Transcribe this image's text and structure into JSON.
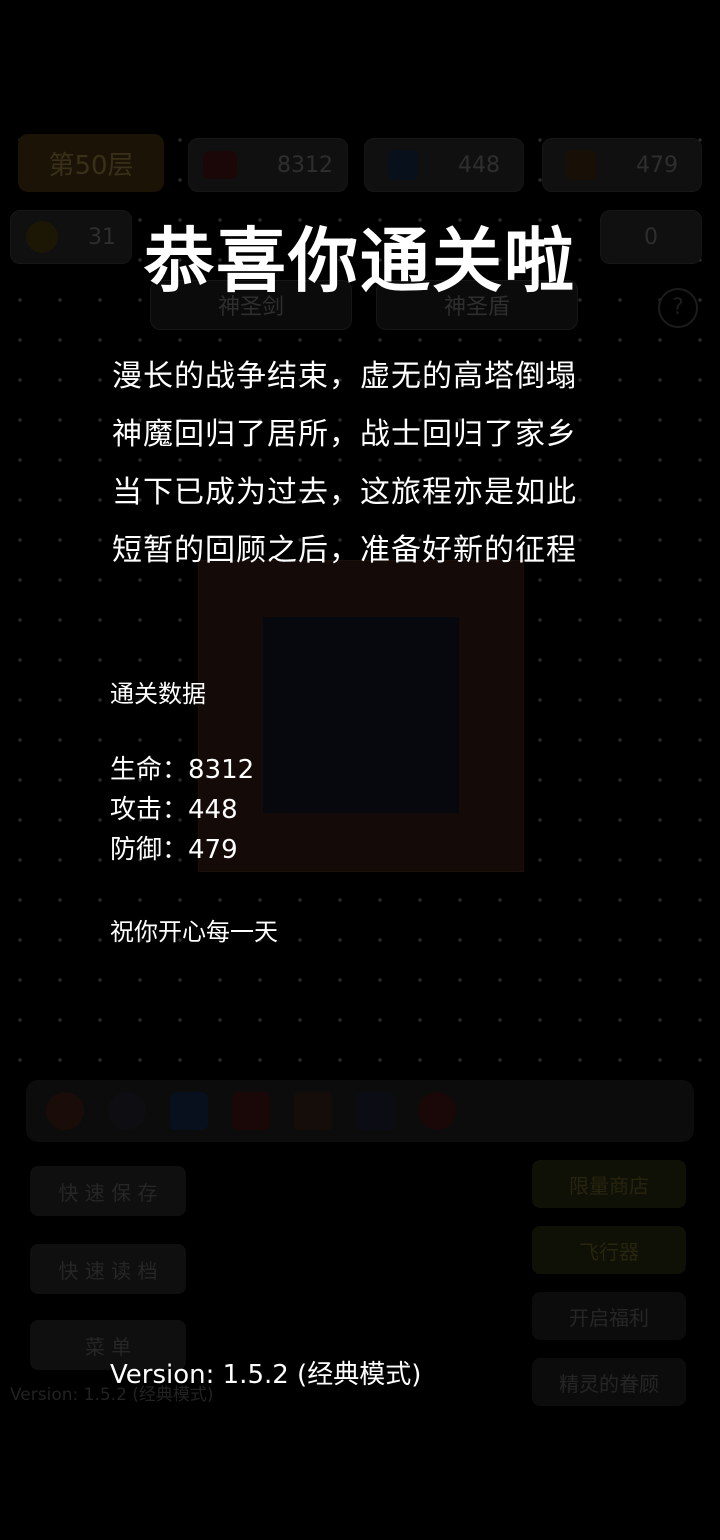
{
  "background_hud": {
    "floor": "第50层",
    "hp": "8312",
    "atk": "448",
    "def": "479",
    "gold": "31",
    "exp": "0",
    "weapon": "神圣剑",
    "shield": "神圣盾",
    "help": "?",
    "buttons": {
      "quick_save": "快 速 保 存",
      "quick_load": "快 速 读 档",
      "menu": "菜 单",
      "shop": "限量商店",
      "flyer": "飞行器",
      "open_box": "开启福利",
      "fairy": "精灵的眷顾"
    },
    "version_bg": "Version: 1.5.2 (经典模式)"
  },
  "overlay": {
    "title": "恭喜你通关啦",
    "poem": [
      "漫长的战争结束，虚无的高塔倒塌",
      "神魔回归了居所，战士回归了家乡",
      "当下已成为过去，这旅程亦是如此",
      "短暂的回顾之后，准备好新的征程"
    ],
    "stats_title": "通关数据",
    "stats": [
      {
        "label": "生命：",
        "value": "8312"
      },
      {
        "label": "攻击：",
        "value": "448"
      },
      {
        "label": "防御：",
        "value": "479"
      }
    ],
    "wish": "祝你开心每一天",
    "version": "Version: 1.5.2 (经典模式)"
  }
}
